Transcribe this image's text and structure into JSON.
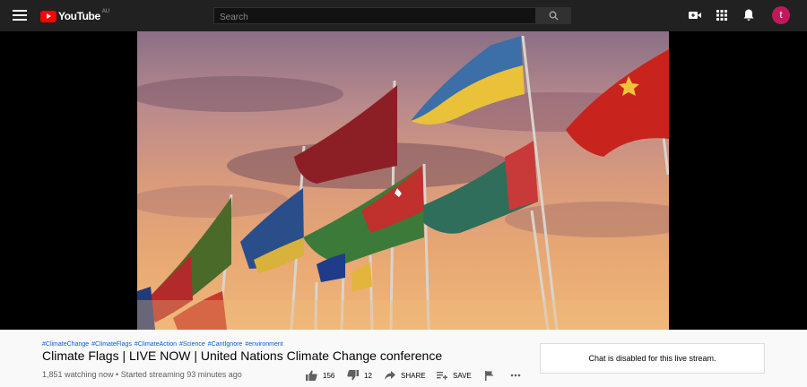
{
  "header": {
    "logo_text": "YouTube",
    "logo_country": "AU",
    "search_placeholder": "Search",
    "avatar_letter": "t",
    "icons": [
      "menu-icon",
      "search-icon",
      "video-camera-icon",
      "apps-grid-icon",
      "bell-icon"
    ]
  },
  "video": {
    "hashtags": [
      "#ClimateChange",
      "#ClimateFlags",
      "#ClimateAction",
      "#Science",
      "#CantIgnore",
      "#environment"
    ],
    "title": "Climate Flags | LIVE NOW | United Nations Climate Change conference",
    "meta": "1,851 watching now • Started streaming 93 minutes ago"
  },
  "actions": {
    "like_count": "156",
    "dislike_count": "12",
    "share_label": "SHARE",
    "save_label": "SAVE"
  },
  "chat": {
    "disabled_text": "Chat is disabled for this live stream."
  },
  "colors": {
    "topbar": "#212121",
    "brand_red": "#ff0000",
    "avatar": "#c2185b",
    "link": "#065fd4"
  }
}
